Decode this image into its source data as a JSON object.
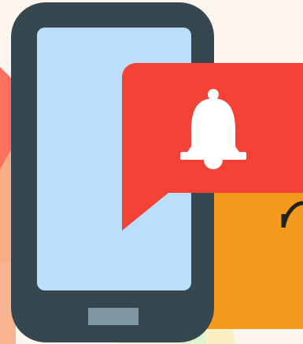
{
  "scene": {
    "description_icons": [
      "smartphone-icon",
      "notification-bell-icon",
      "chat-bubble-icon"
    ],
    "colors": {
      "background": "#fcf6ee",
      "phone_body": "#36474f",
      "phone_screen": "#bbdefb",
      "home_button": "#7e97a3",
      "bubble": "#f44336",
      "bell": "#ffffff",
      "orange_card": "#f39a1c",
      "accent_coral": "#ff6f61",
      "accent_peach": "#f8b08a",
      "accent_green": "#dff5d0",
      "accent_yellow": "#fcefc4"
    }
  }
}
